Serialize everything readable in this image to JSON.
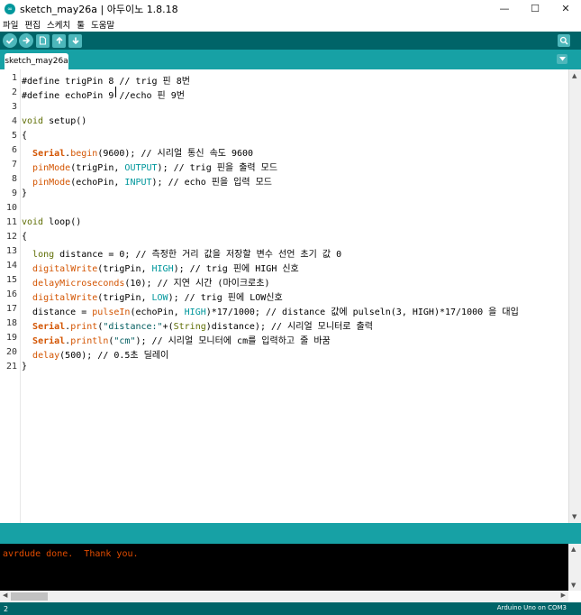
{
  "window": {
    "title": "sketch_may26a | 아두이노 1.8.18",
    "minimize": "—",
    "maximize": "☐",
    "close": "✕"
  },
  "menu": [
    "파일",
    "편집",
    "스케치",
    "툴",
    "도움말"
  ],
  "toolbar": {
    "verify_icon": "check-icon",
    "upload_icon": "arrow-right-icon",
    "new_icon": "new-file-icon",
    "open_icon": "arrow-up-icon",
    "save_icon": "arrow-down-icon",
    "serial_icon": "magnifier-icon"
  },
  "tabs": [
    {
      "label": "sketch_may26a"
    }
  ],
  "code_lines": [
    {
      "n": "1"
    },
    {
      "n": "2"
    },
    {
      "n": "3"
    },
    {
      "n": "4"
    },
    {
      "n": "5"
    },
    {
      "n": "6"
    },
    {
      "n": "7"
    },
    {
      "n": "8"
    },
    {
      "n": "9"
    },
    {
      "n": "10"
    },
    {
      "n": "11"
    },
    {
      "n": "12"
    },
    {
      "n": "13"
    },
    {
      "n": "14"
    },
    {
      "n": "15"
    },
    {
      "n": "16"
    },
    {
      "n": "17"
    },
    {
      "n": "18"
    },
    {
      "n": "19"
    },
    {
      "n": "20"
    },
    {
      "n": "21"
    }
  ],
  "code": {
    "l1": "#define trigPin 8 // trig 핀 8번",
    "l2": "#define echoPin 9 //echo 핀 9번",
    "l4a": "void",
    "l4b": " setup()",
    "l5": "{",
    "l6a": "  ",
    "l6b": "Serial",
    "l6c": ".",
    "l6d": "begin",
    "l6e": "(9600); // 시리얼 통신 속도 9600",
    "l7a": "  ",
    "l7b": "pinMode",
    "l7c": "(trigPin, ",
    "l7d": "OUTPUT",
    "l7e": "); // trig 핀을 출력 모드",
    "l8a": "  ",
    "l8b": "pinMode",
    "l8c": "(echoPin, ",
    "l8d": "INPUT",
    "l8e": "); // echo 핀을 입력 모드",
    "l9": "}",
    "l11a": "void",
    "l11b": " loop()",
    "l12": "{",
    "l13a": "  ",
    "l13b": "long",
    "l13c": " distance = 0; // 측정한 거리 값을 저장할 변수 선언 초기 값 0",
    "l14a": "  ",
    "l14b": "digitalWrite",
    "l14c": "(trigPin, ",
    "l14d": "HIGH",
    "l14e": "); // trig 핀에 HIGH 신호",
    "l15a": "  ",
    "l15b": "delayMicroseconds",
    "l15c": "(10); // 지연 시간 (마이크로초)",
    "l16a": "  ",
    "l16b": "digitalWrite",
    "l16c": "(trigPin, ",
    "l16d": "LOW",
    "l16e": "); // trig 핀에 LOW신호",
    "l17a": "  distance = ",
    "l17b": "pulseIn",
    "l17c": "(echoPin, ",
    "l17d": "HIGH",
    "l17e": ")*17/1000; // distance 값에 pulseln(3, HIGH)*17/1000 을 대입",
    "l18a": "  ",
    "l18b": "Serial",
    "l18c": ".",
    "l18d": "print",
    "l18e": "(",
    "l18f": "\"distance:\"",
    "l18g": "+(",
    "l18h": "String",
    "l18i": ")distance); // 시리얼 모니터로 출력",
    "l19a": "  ",
    "l19b": "Serial",
    "l19c": ".",
    "l19d": "println",
    "l19e": "(",
    "l19f": "\"cm\"",
    "l19g": "); // 시리얼 모니터에 cm를 입력하고 줄 바꿈",
    "l20a": "  ",
    "l20b": "delay",
    "l20c": "(500); // 0.5초 딜레이",
    "l21": "}"
  },
  "console": {
    "text": "avrdude done.  Thank you."
  },
  "status": {
    "line": "2",
    "board": "Arduino Uno on COM3"
  }
}
